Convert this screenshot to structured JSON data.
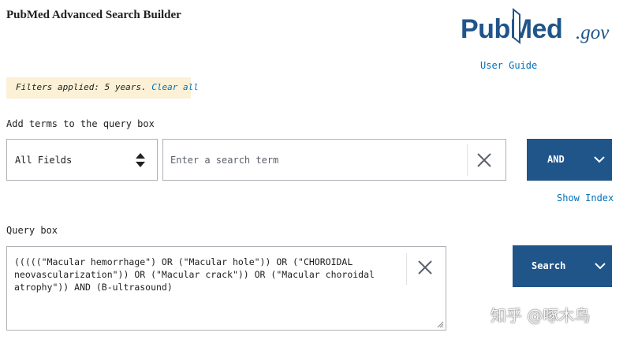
{
  "header": {
    "title": "PubMed Advanced Search Builder",
    "logo": {
      "text": "PubMed",
      "suffix": ".gov"
    },
    "user_guide": "User Guide"
  },
  "filters": {
    "applied_text": "Filters applied: 5 years.",
    "clear_label": "Clear all"
  },
  "add_terms": {
    "label": "Add terms to the query box",
    "field_select": "All Fields",
    "search_placeholder": "Enter a search term",
    "operator_label": "AND",
    "show_index": "Show Index"
  },
  "query": {
    "label": "Query box",
    "text": "(((((\"Macular hemorrhage\") OR (\"Macular hole\")) OR (\"CHOROIDAL\nneovascularization\")) OR (\"Macular crack\")) OR (\"Macular choroidal\natrophy\")) AND (B-ultrasound)",
    "search_label": "Search"
  },
  "watermark": "知乎 @啄木鸟",
  "colors": {
    "brand": "#20558a",
    "link": "#0071bc",
    "banner": "#fcf1d6"
  },
  "icons": [
    "sort-arrows-icon",
    "close-icon",
    "chevron-down-icon",
    "resize-handle-icon",
    "book-icon"
  ]
}
